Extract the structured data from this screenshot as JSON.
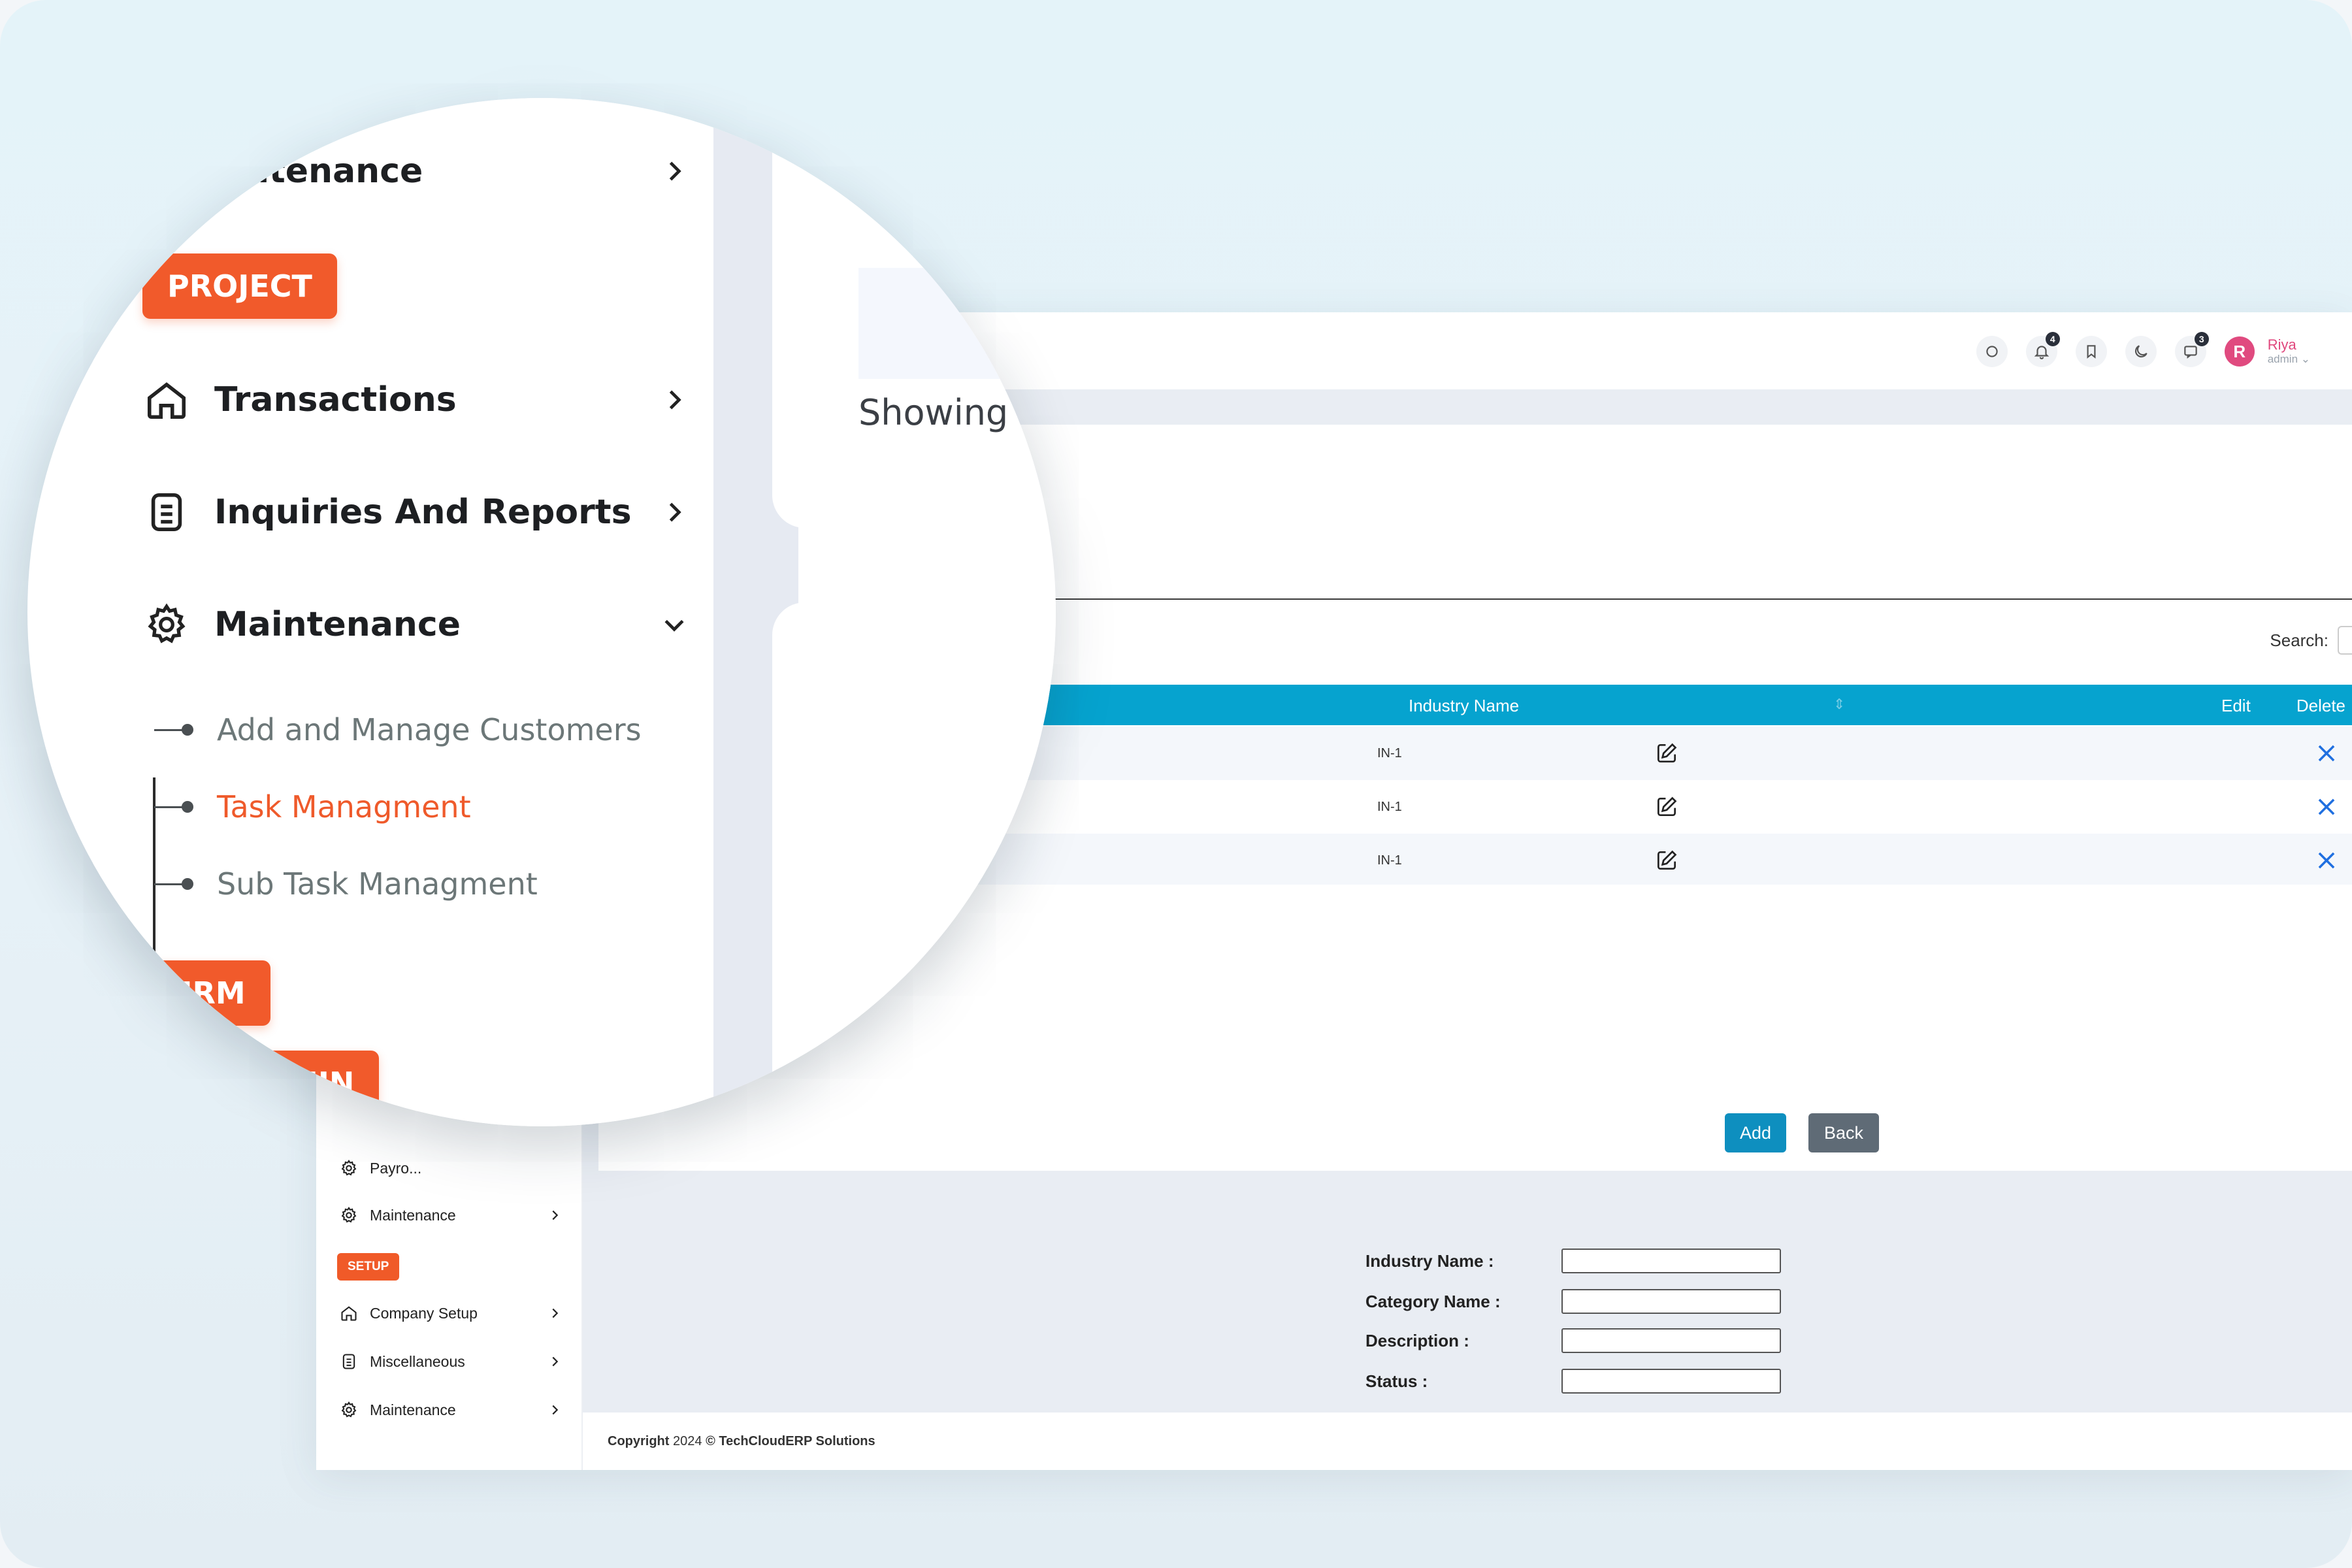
{
  "header": {
    "notifications_count": "4",
    "messages_count": "3",
    "user_initial": "R",
    "user_name": "Riya",
    "user_role": "admin"
  },
  "table": {
    "search_label": "Search:",
    "columns": {
      "industry_name": "Industry Name",
      "edit": "Edit",
      "delete": "Delete"
    },
    "rows": [
      {
        "industry_name": "IN-1"
      },
      {
        "industry_name": "IN-1"
      },
      {
        "industry_name": "IN-1"
      }
    ]
  },
  "form": {
    "industry_name_label": "Industry Name :",
    "category_name_label": "Category Name :",
    "description_label": "Description :",
    "status_label": "Status :",
    "industry_name_value": "",
    "category_name_value": "",
    "description_value": "",
    "status_value": "",
    "add_label": "Add",
    "back_label": "Back"
  },
  "footer": {
    "prefix": "Copyright",
    "year": "2024",
    "suffix": "© TechCloudERP Solutions"
  },
  "sidebar_small": {
    "payroll_partial": "Payro...",
    "maintenance_1": "Maintenance",
    "setup_badge": "SETUP",
    "company_setup": "Company Setup",
    "miscellaneous": "Miscellaneous",
    "maintenance_2": "Maintenance"
  },
  "magnified": {
    "maintenance_top_partial": "aintenance",
    "project_badge": "PROJECT",
    "transactions": "Transactions",
    "inquiries_reports": "Inquiries And Reports",
    "maintenance": "Maintenance",
    "sub_items": [
      "Add and Manage Customers",
      "Task Managment",
      "Sub Task Managment"
    ],
    "hrm_badge": "HRM",
    "hrm_admin_partial": "RM ADMIN",
    "showing_partial": "Showing"
  },
  "colors": {
    "accent_orange": "#f15a2b",
    "table_header": "#06a3cf",
    "add_button": "#0e8fbf",
    "back_button": "#5f6b76",
    "delete_icon": "#1f6fe0",
    "user_accent": "#e0477d"
  }
}
